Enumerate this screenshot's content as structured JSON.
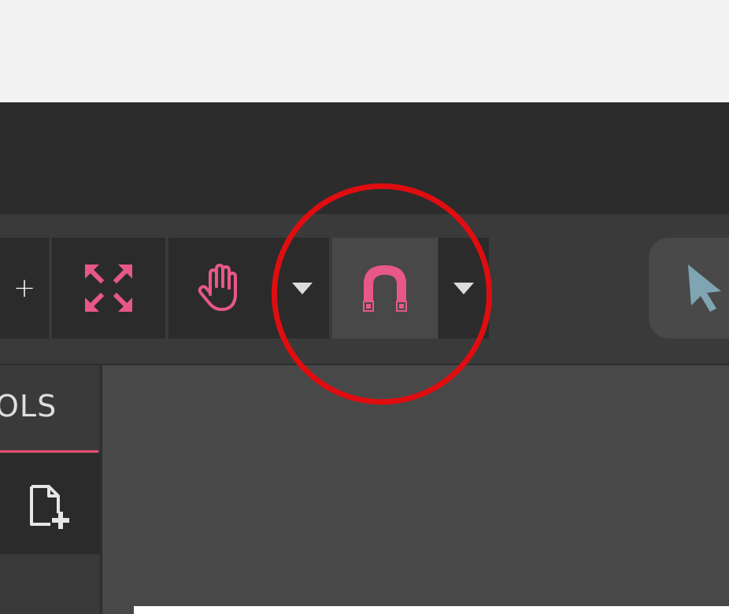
{
  "toolbar": {
    "zoom_in_label": "+",
    "fit_view_icon": "fit-view-icon",
    "pan_tool_icon": "hand-icon",
    "snap_tool_icon": "magnet-icon",
    "select_tool_icon": "cursor-arrow-icon",
    "active_tool": "snap"
  },
  "left_panel": {
    "title": "OLS",
    "new_document_icon": "new-document-icon"
  },
  "colors": {
    "accent": "#e8578a",
    "highlight": "#e00d10",
    "cursor": "#7fa5b2"
  }
}
